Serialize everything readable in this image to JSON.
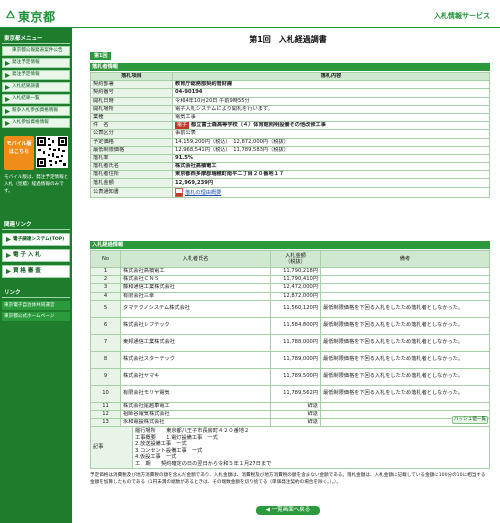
{
  "header": {
    "logo_text": "東京都",
    "service_title": "入札情報サービス"
  },
  "sidebar": {
    "menu_heading": "東京都メニュー",
    "menu_items": [
      "東京都公報発表案件公告",
      "発注予定情報",
      "発注予定情報",
      "入札結果調書",
      "入札結果一覧",
      "競争入札参加資格情報",
      "入札参加資格情報"
    ],
    "mobile_label": "モバイル版",
    "mobile_sub": "はこちら",
    "mobile_note": "モバイル版は、発注予定情報と入札（見積）経過情報のみです。",
    "related_heading": "関連リンク",
    "buttons": [
      "電子調達システム(TOP)",
      "電 子 入 札",
      "資 格 審 査"
    ],
    "links_heading": "リンク",
    "links": [
      "東京電子自治体共同運営",
      "東京都公式ホームページ"
    ]
  },
  "main": {
    "page_title": "第1回　入札経過調書",
    "tab_label": "第1回",
    "section_info": "落札者情報",
    "info_header": [
      "落札項目",
      "落札内容"
    ],
    "info_rows": [
      {
        "k": "契約部署",
        "v": "教育庁総務部契約管財課"
      },
      {
        "k": "契約番号",
        "v": "04-90194"
      },
      {
        "k": "開札日時",
        "v": "令和4年10月20日 午前9時55分"
      },
      {
        "k": "開札場所",
        "v": "電子入札システムにより開札を行います。"
      },
      {
        "k": "業種",
        "v": "電気工事"
      },
      {
        "k": "件　名",
        "tag": "電子",
        "v": "都立富士森高等学校（４）体育館照明設備その他改修工事"
      },
      {
        "k": "公表区分",
        "v": "事前公表"
      },
      {
        "k": "予定価格",
        "v": "14,159,200円（税込）　12,872,000円（税抜）"
      },
      {
        "k": "最低制限価格",
        "v": "12,968,541円（税込）　11,789,583円（税抜）"
      },
      {
        "k": "落札率",
        "v": "91.5%"
      },
      {
        "k": "落札者氏名",
        "v": "株式会社高橋電工"
      },
      {
        "k": "落札者住所",
        "v": "東京都西多摩郡瑞穂町南平二丁目２０番地１７"
      },
      {
        "k": "落札金額",
        "v": "12,969,239円"
      },
      {
        "k": "公表通知書",
        "v": "落札の理由概要"
      }
    ],
    "section_bids": "入札経過情報",
    "bid_header": [
      "No",
      "入札者氏名",
      "入札金額\n（税抜）",
      "備考"
    ],
    "bids": [
      {
        "no": "1",
        "name": "株式会社高橋電工",
        "amount": "11,790,218円",
        "note": ""
      },
      {
        "no": "2",
        "name": "株式会社ＣＮＳ",
        "amount": "11,790,410円",
        "note": ""
      },
      {
        "no": "3",
        "name": "藤和通信工業株式会社",
        "amount": "12,472,000円",
        "note": ""
      },
      {
        "no": "4",
        "name": "有限会社三幸",
        "amount": "12,872,000円",
        "note": ""
      },
      {
        "no": "5",
        "name": "タマテクノシステム株式会社",
        "amount": "11,560,120円",
        "note": "最低制限価格を下回る入札をしたため落札者としなかった。"
      },
      {
        "no": "6",
        "name": "株式会社レフテック",
        "amount": "11,584,800円",
        "note": "最低制限価格を下回る入札をしたため落札者としなかった。"
      },
      {
        "no": "7",
        "name": "東邦通信工業株式会社",
        "amount": "11,788,000円",
        "note": "最低制限価格を下回る入札をしたため落札者としなかった。"
      },
      {
        "no": "8",
        "name": "株式会社スターテック",
        "amount": "11,789,000円",
        "note": "最低制限価格を下回る入札をしたため落札者としなかった。"
      },
      {
        "no": "9",
        "name": "株式会社ヤマキ",
        "amount": "11,789,500円",
        "note": "最低制限価格を下回る入札をしたため落札者としなかった。"
      },
      {
        "no": "10",
        "name": "有限会社モリヤ電気",
        "amount": "11,789,562円",
        "note": "最低制限価格を下回る入札をしたため落札者としなかった。"
      },
      {
        "no": "11",
        "name": "株式会社尾越車電工",
        "amount": "辞退",
        "note": ""
      },
      {
        "no": "12",
        "name": "祖師谷電気株式会社",
        "amount": "辞退",
        "note": ""
      },
      {
        "no": "13",
        "name": "永和電設株式会社",
        "amount": "辞退",
        "note": ""
      },
      {
        "no": "14",
        "name": "幸和防災株式会社",
        "amount": "辞退",
        "note": ""
      },
      {
        "no": "15",
        "name": "丸武工業株式会社",
        "amount": "辞退",
        "note": ""
      }
    ],
    "hash_button": "ハッシュ値一覧",
    "memo_label": "記事",
    "memo_lines": [
      "履行場所　　東京都八王子市長房町４２０番地２",
      "工事概要　　1.電灯設備工事　一式",
      "2.放送設備工事　一式",
      "3.コンセント設備工事　一式",
      "4.仮設工事　一式",
      "工　期　　契約確定の日の翌日から令和５年１月27日まで"
    ],
    "footnote": "予定価格は消費税及び地方消費税の額を含んだ金額であり、入札金額は、消費税及び地方消費税の額を含まない金額である。落札金額は、入札金額に記載している金額に100分の10に相当する金額を加算したものである（1円未満の端数があるときは、その端数金額を切り捨てる（単価発注契約の場合を除く。）。）。",
    "back_button": "◀ 一覧画面へ戻る"
  },
  "colors": {
    "brand_green": "#1f8f3a",
    "sidebar_green": "#1d7d2c",
    "header_row": "#cfe8cf",
    "key_cell": "#e8f4e8",
    "mobile_orange": "#f08c1a",
    "tag_red": "#c0392b"
  }
}
